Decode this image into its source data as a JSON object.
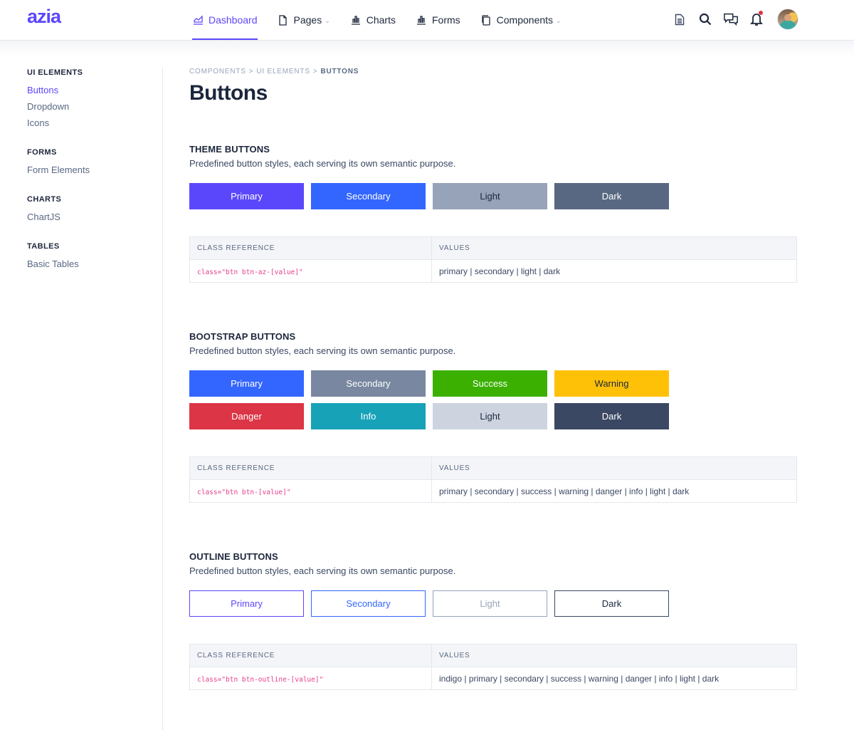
{
  "app": {
    "logo": "azia"
  },
  "nav": {
    "items": [
      {
        "label": "Dashboard",
        "icon": "chart-area-icon",
        "active": true,
        "dropdown": false
      },
      {
        "label": "Pages",
        "icon": "file-icon",
        "active": false,
        "dropdown": true
      },
      {
        "label": "Charts",
        "icon": "bar-chart-icon",
        "active": false,
        "dropdown": false
      },
      {
        "label": "Forms",
        "icon": "bar-chart-icon",
        "active": false,
        "dropdown": false
      },
      {
        "label": "Components",
        "icon": "copy-icon",
        "active": false,
        "dropdown": true
      }
    ],
    "right_icons": [
      "document-icon",
      "search-icon",
      "chat-icon",
      "bell-icon"
    ],
    "has_notification": true
  },
  "sidebar": {
    "groups": [
      {
        "title": "UI ELEMENTS",
        "links": [
          {
            "label": "Buttons",
            "active": true
          },
          {
            "label": "Dropdown",
            "active": false
          },
          {
            "label": "Icons",
            "active": false
          }
        ]
      },
      {
        "title": "FORMS",
        "links": [
          {
            "label": "Form Elements",
            "active": false
          }
        ]
      },
      {
        "title": "CHARTS",
        "links": [
          {
            "label": "ChartJS",
            "active": false
          }
        ]
      },
      {
        "title": "TABLES",
        "links": [
          {
            "label": "Basic Tables",
            "active": false
          }
        ]
      }
    ]
  },
  "breadcrumb": {
    "items": [
      "COMPONENTS",
      "UI ELEMENTS"
    ],
    "current": "BUTTONS",
    "separator": ">"
  },
  "page_title": "Buttons",
  "colors": {
    "accent": "#5b47fb",
    "code": "#e83e8c"
  },
  "sections": [
    {
      "title": "THEME BUTTONS",
      "description": "Predefined button styles, each serving its own semantic purpose.",
      "buttons": [
        {
          "label": "Primary",
          "bg": "#5b47fb",
          "fg": "#ffffff"
        },
        {
          "label": "Secondary",
          "bg": "#3366ff",
          "fg": "#ffffff"
        },
        {
          "label": "Light",
          "bg": "#97a3b9",
          "fg": "#1c273c"
        },
        {
          "label": "Dark",
          "bg": "#596882",
          "fg": "#ffffff"
        }
      ],
      "table": {
        "headers": [
          "CLASS REFERENCE",
          "VALUES"
        ],
        "class_ref": "class=\"btn btn-az-[value]\"",
        "values": "primary | secondary | light | dark"
      }
    },
    {
      "title": "BOOTSTRAP BUTTONS",
      "description": "Predefined button styles, each serving its own semantic purpose.",
      "buttons": [
        {
          "label": "Primary",
          "bg": "#3366ff",
          "fg": "#ffffff"
        },
        {
          "label": "Secondary",
          "bg": "#7987a1",
          "fg": "#ffffff"
        },
        {
          "label": "Success",
          "bg": "#3bb001",
          "fg": "#ffffff"
        },
        {
          "label": "Warning",
          "bg": "#ffc107",
          "fg": "#1c273c"
        },
        {
          "label": "Danger",
          "bg": "#dc3545",
          "fg": "#ffffff"
        },
        {
          "label": "Info",
          "bg": "#17a2b8",
          "fg": "#ffffff"
        },
        {
          "label": "Light",
          "bg": "#cdd4e0",
          "fg": "#1c273c"
        },
        {
          "label": "Dark",
          "bg": "#3b4863",
          "fg": "#ffffff"
        }
      ],
      "table": {
        "headers": [
          "CLASS REFERENCE",
          "VALUES"
        ],
        "class_ref": "class=\"btn btn-[value]\"",
        "values": "primary | secondary | success | warning | danger | info | light | dark"
      }
    },
    {
      "title": "OUTLINE BUTTONS",
      "description": "Predefined button styles, each serving its own semantic purpose.",
      "outline": true,
      "buttons": [
        {
          "label": "Primary",
          "bg": "#ffffff",
          "fg": "#5b47fb",
          "border": "#5b47fb"
        },
        {
          "label": "Secondary",
          "bg": "#ffffff",
          "fg": "#3366ff",
          "border": "#3366ff"
        },
        {
          "label": "Light",
          "bg": "#ffffff",
          "fg": "#97a3b9",
          "border": "#97a3b9"
        },
        {
          "label": "Dark",
          "bg": "#ffffff",
          "fg": "#1c273c",
          "border": "#3b4863"
        }
      ],
      "table": {
        "headers": [
          "CLASS REFERENCE",
          "VALUES"
        ],
        "class_ref": "class=\"btn btn-outline-[value]\"",
        "values": "indigo | primary | secondary | success | warning | danger | info | light | dark"
      }
    }
  ]
}
